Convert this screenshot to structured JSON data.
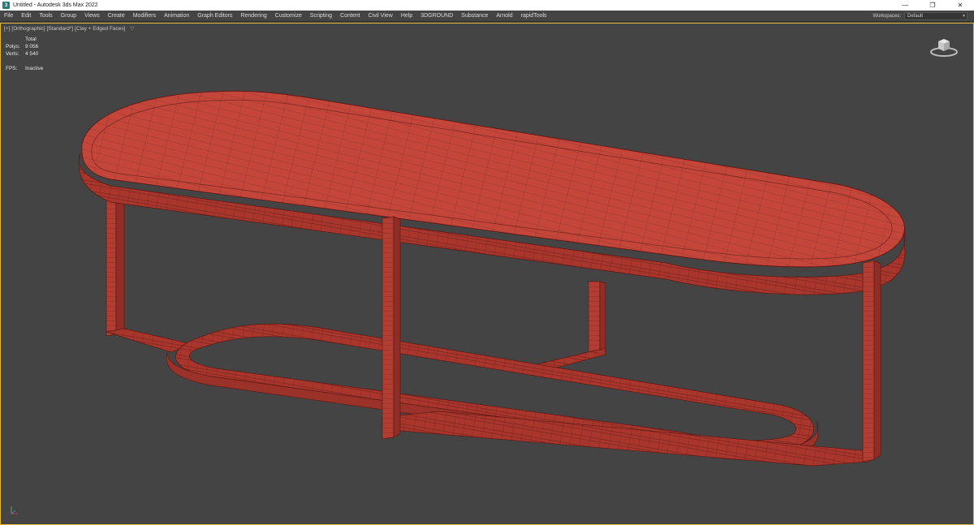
{
  "window": {
    "title": "Untitled - Autodesk 3ds Max 2022",
    "controls": [
      "—",
      "❐",
      "✕"
    ]
  },
  "menubar": {
    "items": [
      "File",
      "Edit",
      "Tools",
      "Group",
      "Views",
      "Create",
      "Modifiers",
      "Animation",
      "Graph Editors",
      "Rendering",
      "Customize",
      "Scripting",
      "Content",
      "Civil View",
      "Help",
      "3DGROUND",
      "Substance",
      "Arnold",
      "rapidTools"
    ]
  },
  "workspaces": {
    "label": "Workspaces:",
    "value": "Default"
  },
  "viewport": {
    "labels": [
      "[+]",
      "[Orthographic]",
      "[Standard*]",
      "[Clay + Edged Faces]"
    ],
    "filter_icon": "▽",
    "stats": {
      "header": "Total",
      "polys_label": "Polys:",
      "polys_value": "9 056",
      "verts_label": "Verts:",
      "verts_value": "4 540",
      "fps_label": "FPS:",
      "fps_value": "Inactive"
    },
    "model_color": "#c4463b",
    "wire_color": "#6e1f18",
    "background_color": "#444444",
    "active_border_color": "#e0b93a"
  }
}
